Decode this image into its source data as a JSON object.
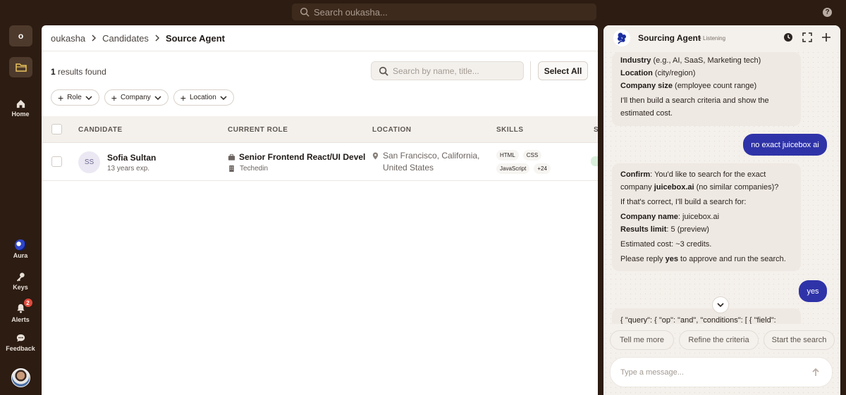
{
  "topbar": {
    "search_placeholder": "Search oukasha...",
    "help": "?"
  },
  "rail": {
    "org_initial": "o",
    "items": [
      {
        "label": "Home",
        "icon": "home-icon"
      },
      {
        "label": "Aura",
        "icon": "aura-logo-icon"
      },
      {
        "label": "Keys",
        "icon": "key-icon"
      },
      {
        "label": "Alerts",
        "icon": "bell-icon",
        "badge": "2"
      },
      {
        "label": "Feedback",
        "icon": "chat-icon"
      }
    ]
  },
  "breadcrumb": {
    "root": "oukasha",
    "middle": "Candidates",
    "current": "Source Agent"
  },
  "results": {
    "count": "1",
    "label": "results found"
  },
  "search": {
    "placeholder": "Search by name, title..."
  },
  "select_all": "Select All",
  "filters": [
    "Role",
    "Company",
    "Location"
  ],
  "table": {
    "headers": [
      "CANDIDATE",
      "CURRENT ROLE",
      "LOCATION",
      "SKILLS",
      "S"
    ],
    "rows": [
      {
        "initials": "SS",
        "name": "Sofia Sultan",
        "experience": "13 years exp.",
        "role": "Senior Frontend React/UI Devel",
        "company": "Techedin",
        "location_line1": "San Francisco, California,",
        "location_line2": "United States",
        "skills": [
          "HTML",
          "CSS",
          "JavaScript",
          "+24"
        ]
      }
    ]
  },
  "agent": {
    "title": "Sourcing Agent",
    "status": "• Listening",
    "messages": {
      "m1": {
        "industry_label": "Industry",
        "industry_text": " (e.g., AI, SaaS, Marketing tech)",
        "location_label": "Location",
        "location_text": " (city/region)",
        "size_label": "Company size",
        "size_text": " (employee count range)",
        "outro": "I'll then build a search criteria and show the estimated cost."
      },
      "user1": "no exact juicebox ai",
      "m2": {
        "confirm_label": "Confirm",
        "confirm_text_a": ": You'd like to search for the exact company ",
        "confirm_company": "juicebox.ai",
        "confirm_text_b": " (no similar companies)?",
        "line2": "If that's correct, I'll build a search for:",
        "name_label": "Company name",
        "name_value": ": juicebox.ai",
        "limit_label": "Results limit",
        "limit_value": ": 5 (preview)",
        "cost": "Estimated cost: ~3 credits.",
        "reply_a": "Please reply ",
        "reply_yes": "yes",
        "reply_b": " to approve and run the search."
      },
      "user2": "yes",
      "m3_partial": "{ \"query\": { \"op\": \"and\", \"conditions\": [ { \"field\":"
    },
    "suggestions": [
      "Tell me more",
      "Refine the criteria",
      "Start the search"
    ],
    "compose_placeholder": "Type a message..."
  },
  "colors": {
    "background": "#2c1c12",
    "accent": "#2f33a8",
    "panel": "#f4f0eb"
  }
}
